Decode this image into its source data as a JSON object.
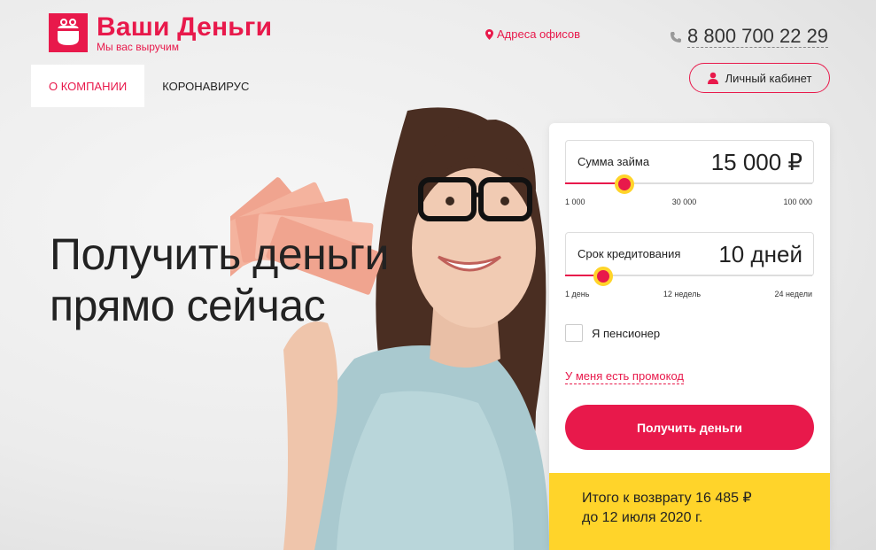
{
  "brand": {
    "name": "Ваши Деньги",
    "tagline": "Мы вас выручим",
    "color": "#e8194b"
  },
  "header": {
    "address_link": "Адреса офисов",
    "phone": "8 800 700 22 29",
    "cabinet_label": "Личный кабинет"
  },
  "nav": {
    "items": [
      {
        "label": "О КОМПАНИИ",
        "active": true
      },
      {
        "label": "КОРОНАВИРУС",
        "active": false
      }
    ]
  },
  "hero": {
    "line1": "Получить деньги",
    "line2": "прямо сейчас"
  },
  "form": {
    "amount": {
      "label": "Сумма займа",
      "value": "15 000 ₽",
      "fraction": 0.24,
      "ticks": [
        "1 000",
        "30 000",
        "100 000"
      ]
    },
    "term": {
      "label": "Срок кредитования",
      "value": "10 дней",
      "fraction": 0.155,
      "ticks": [
        "1 день",
        "12 недель",
        "24 недели"
      ]
    },
    "pensioner_label": "Я пенсионер",
    "promo_link": "У меня есть промокод",
    "submit_label": "Получить деньги",
    "total_line1": "Итого к возврату 16 485 ₽",
    "total_line2": "до 12 июля 2020 г."
  },
  "colors": {
    "accent": "#e8194b",
    "yellow": "#ffd42a"
  }
}
